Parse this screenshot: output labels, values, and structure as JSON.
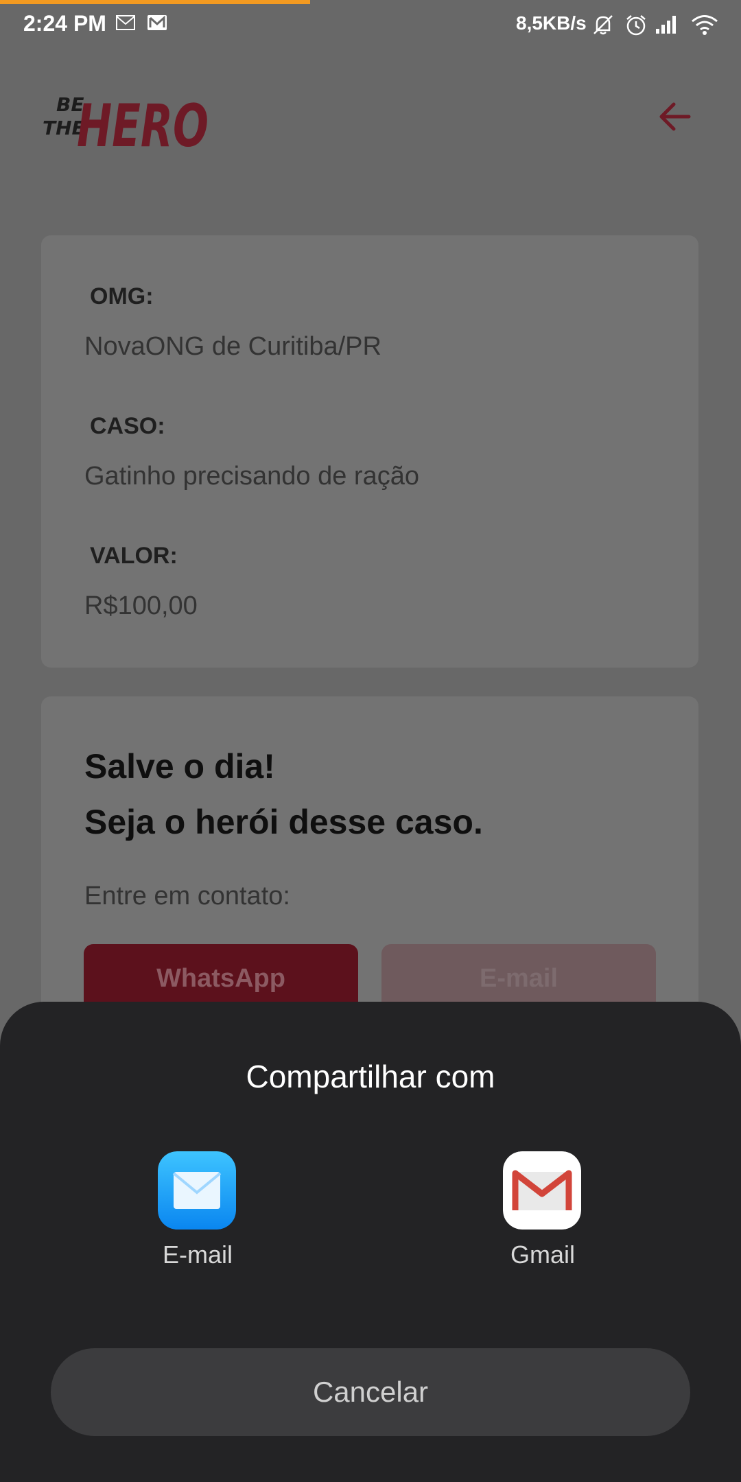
{
  "status_bar": {
    "time": "2:24 PM",
    "network_speed": "8,5KB/s",
    "icons": [
      "mail-outline-icon",
      "gmail-icon",
      "bell-muted-icon",
      "alarm-icon",
      "signal-icon",
      "wifi-icon"
    ]
  },
  "header": {
    "logo_line1": "BE",
    "logo_line2": "THE",
    "logo_word": "HERO",
    "back_icon": "arrow-left-icon",
    "accent_color": "#6e1a26"
  },
  "case_card": {
    "org_label": "OMG:",
    "org_value": "NovaONG de Curitiba/PR",
    "case_label": "CASO:",
    "case_value": "Gatinho precisando de ração",
    "value_label": "VALOR:",
    "value_value": "R$100,00"
  },
  "contact_card": {
    "title_line1": "Salve o dia!",
    "title_line2": "Seja o herói desse caso.",
    "contact_label": "Entre em contato:",
    "whatsapp_label": "WhatsApp",
    "email_label": "E-mail"
  },
  "share_sheet": {
    "title": "Compartilhar com",
    "apps": [
      {
        "label": "E-mail",
        "icon": "email-app-icon"
      },
      {
        "label": "Gmail",
        "icon": "gmail-app-icon"
      }
    ],
    "cancel_label": "Cancelar"
  }
}
